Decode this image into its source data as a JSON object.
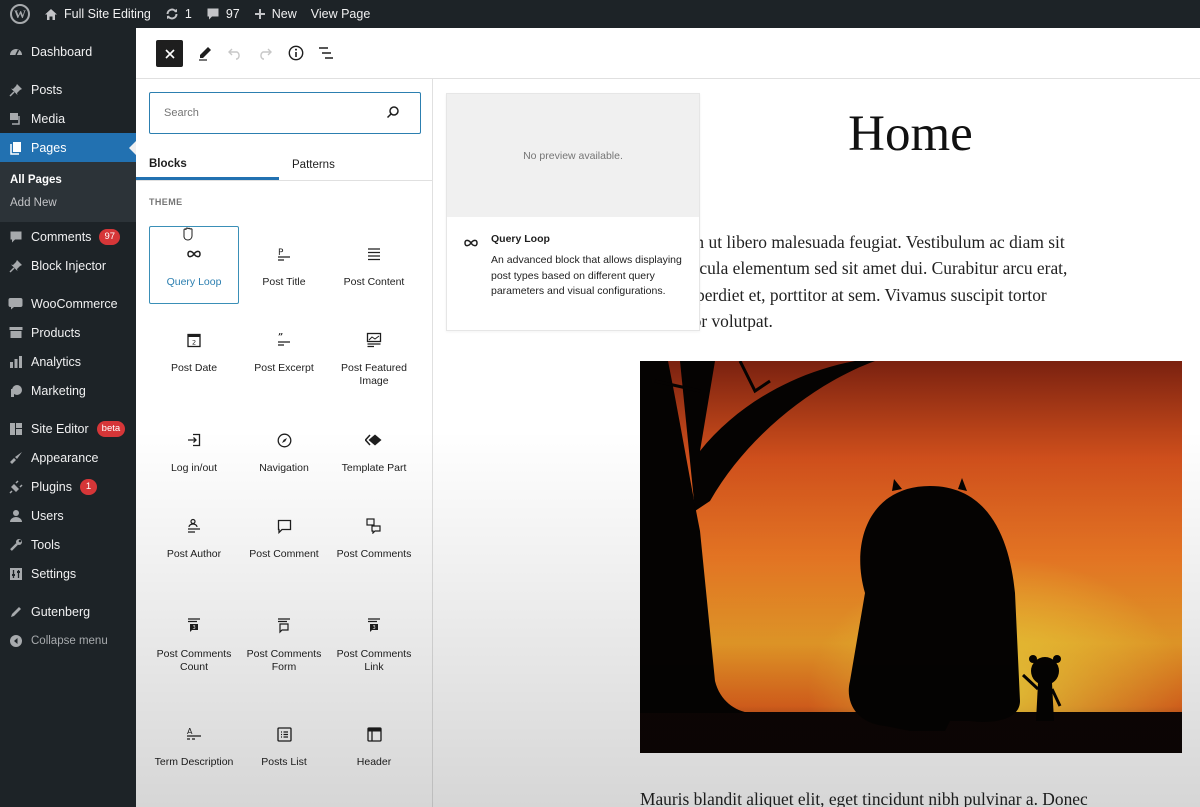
{
  "adminbar": {
    "site_name": "Full Site Editing",
    "updates_count": "1",
    "comments_count": "97",
    "new_label": "New",
    "view_label": "View Page"
  },
  "menu": {
    "items": [
      {
        "label": "Dashboard",
        "icon": "dashboard-icon"
      },
      {
        "label": "Posts",
        "icon": "pin-icon"
      },
      {
        "label": "Media",
        "icon": "media-icon"
      },
      {
        "label": "Pages",
        "icon": "pages-icon",
        "active": true
      },
      {
        "label": "Comments",
        "icon": "comment-icon",
        "badge": "97"
      },
      {
        "label": "Block Injector",
        "icon": "pin-icon"
      },
      {
        "label": "WooCommerce",
        "icon": "woo-icon"
      },
      {
        "label": "Products",
        "icon": "archive-icon"
      },
      {
        "label": "Analytics",
        "icon": "bar-chart-icon"
      },
      {
        "label": "Marketing",
        "icon": "megaphone-icon"
      },
      {
        "label": "Site Editor",
        "icon": "layout-icon",
        "badge": "beta"
      },
      {
        "label": "Appearance",
        "icon": "brush-icon"
      },
      {
        "label": "Plugins",
        "icon": "plug-icon",
        "badge": "1"
      },
      {
        "label": "Users",
        "icon": "user-icon"
      },
      {
        "label": "Tools",
        "icon": "wrench-icon"
      },
      {
        "label": "Settings",
        "icon": "sliders-icon"
      },
      {
        "label": "Gutenberg",
        "icon": "pencil-icon"
      },
      {
        "label": "Collapse menu",
        "icon": "collapse-icon"
      }
    ],
    "submenu": [
      {
        "label": "All Pages",
        "current": true
      },
      {
        "label": "Add New"
      }
    ]
  },
  "toolbar": {
    "close_label": "×"
  },
  "inserter": {
    "search_placeholder": "Search",
    "tabs": [
      {
        "label": "Blocks",
        "active": true
      },
      {
        "label": "Patterns"
      }
    ],
    "section_title": "THEME",
    "blocks": [
      {
        "label": "Query Loop",
        "icon": "loop-icon",
        "selected": true
      },
      {
        "label": "Post Title",
        "icon": "post-title-icon"
      },
      {
        "label": "Post Content",
        "icon": "post-content-icon"
      },
      {
        "label": "Post Date",
        "icon": "calendar-icon"
      },
      {
        "label": "Post Excerpt",
        "icon": "excerpt-icon"
      },
      {
        "label": "Post Featured Image",
        "icon": "featured-image-icon"
      },
      {
        "label": "Log in/out",
        "icon": "login-icon"
      },
      {
        "label": "Navigation",
        "icon": "compass-icon"
      },
      {
        "label": "Template Part",
        "icon": "template-part-icon"
      },
      {
        "label": "Post Author",
        "icon": "author-icon"
      },
      {
        "label": "Post Comment",
        "icon": "comment-bubble-icon"
      },
      {
        "label": "Post Comments",
        "icon": "comments-icon"
      },
      {
        "label": "Post Comments Count",
        "icon": "comments-count-icon"
      },
      {
        "label": "Post Comments Form",
        "icon": "comments-form-icon"
      },
      {
        "label": "Post Comments Link",
        "icon": "comments-link-icon"
      },
      {
        "label": "Term Description",
        "icon": "term-description-icon"
      },
      {
        "label": "Posts List",
        "icon": "posts-list-icon"
      },
      {
        "label": "Header",
        "icon": "header-icon"
      }
    ]
  },
  "preview": {
    "no_preview": "No preview available.",
    "title": "Query Loop",
    "description": "An advanced block that allows displaying post types based on different query parameters and visual configurations."
  },
  "canvas": {
    "title": "Home",
    "paragraph_lines": [
      "uis lorem ut libero malesuada feugiat. Vestibulum ac diam sit",
      "iam vehicula elementum sed sit amet dui. Curabitur arcu erat,",
      "an id imperdiet et, porttitor at sem. Vivamus suscipit tortor",
      "s porttitor volutpat."
    ],
    "paragraph2": "Mauris blandit aliquet elit, eget tincidunt nibh pulvinar a. Donec",
    "image_alt": "Silhouette of a large monster and a small creature at sunset under a tree"
  },
  "colors": {
    "accent": "#2271b1",
    "admin_bg": "#1d2327",
    "badge": "#d63638",
    "selected_border": "#3a8fb7"
  }
}
